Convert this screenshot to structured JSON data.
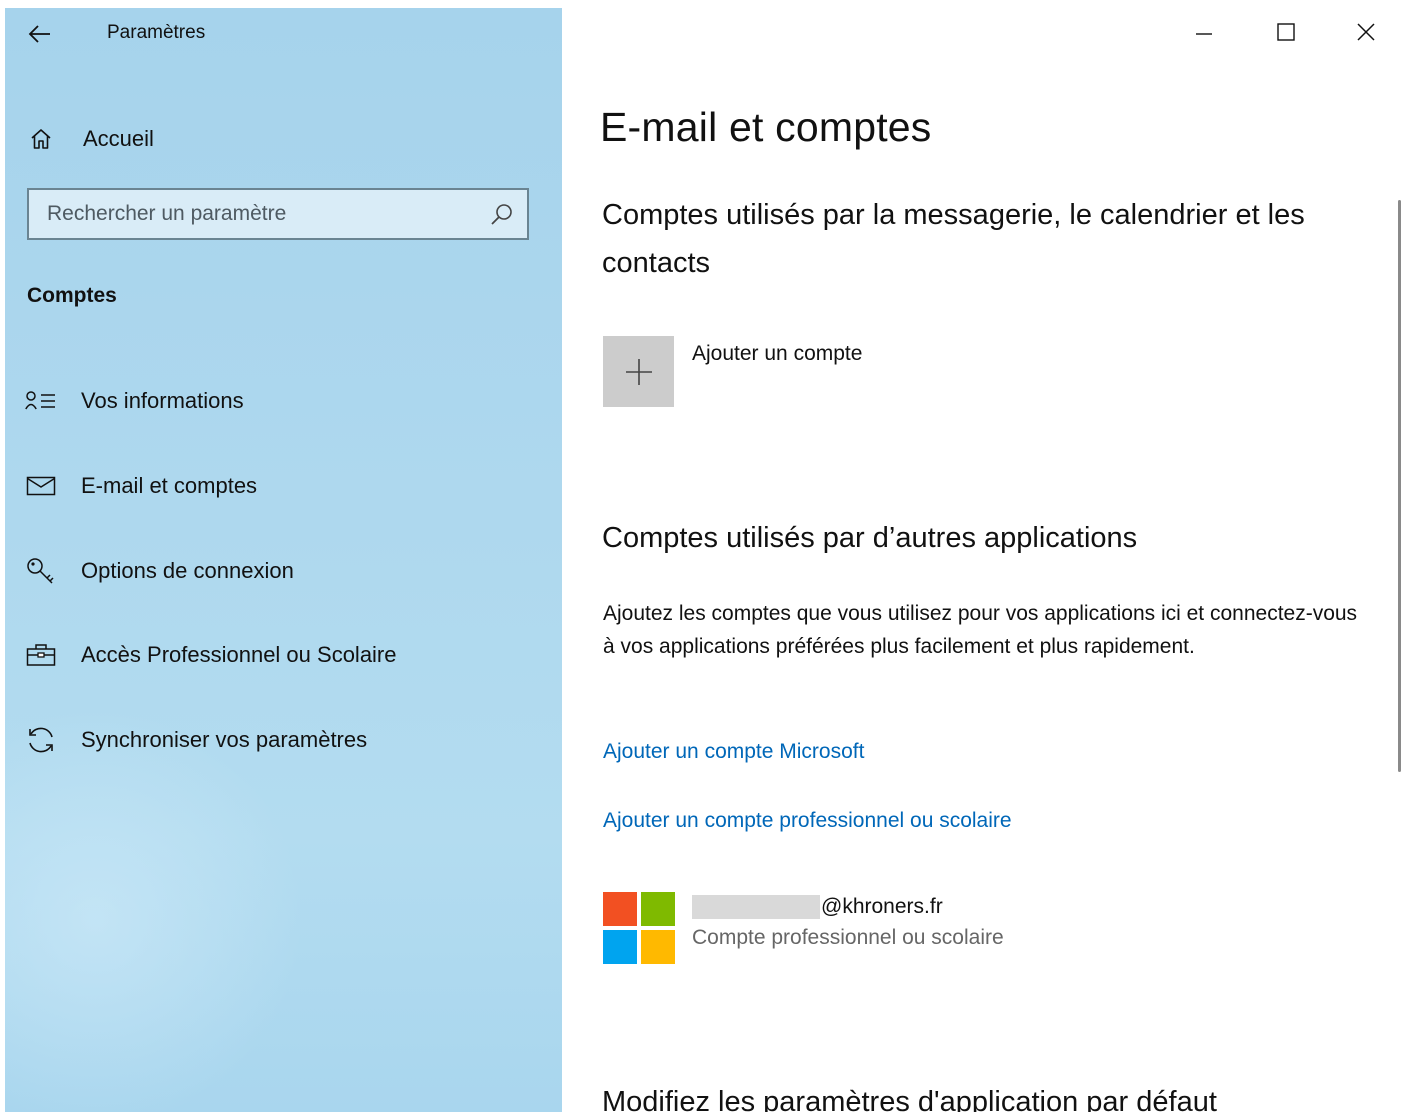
{
  "window": {
    "title": "Paramètres"
  },
  "sidebar": {
    "home_label": "Accueil",
    "search": {
      "placeholder": "Rechercher un paramètre",
      "value": ""
    },
    "section_label": "Comptes",
    "items": [
      {
        "label": "Vos informations",
        "icon": "person-list-icon"
      },
      {
        "label": "E-mail et comptes",
        "icon": "mail-icon"
      },
      {
        "label": "Options de connexion",
        "icon": "key-icon"
      },
      {
        "label": "Accès Professionnel ou Scolaire",
        "icon": "briefcase-icon"
      },
      {
        "label": "Synchroniser vos paramètres",
        "icon": "sync-icon"
      }
    ],
    "background_color": "#aed8ee"
  },
  "main": {
    "page_title": "E-mail et comptes",
    "section1": {
      "heading": "Comptes utilisés par la messagerie, le calendrier et les contacts",
      "add_account_label": "Ajouter un compte"
    },
    "section2": {
      "heading": "Comptes utilisés par d’autres applications",
      "description": "Ajoutez les comptes que vous utilisez pour vos applications ici et connectez-vous à vos applications préférées plus facilement et plus rapidement.",
      "link_microsoft": "Ajouter un compte Microsoft",
      "link_work": "Ajouter un compte professionnel ou scolaire",
      "account": {
        "email_suffix": "@khroners.fr",
        "type": "Compte professionnel ou scolaire"
      }
    },
    "section3": {
      "heading": "Modifiez les paramètres d'application par défaut"
    }
  },
  "colors": {
    "link": "#0067b8",
    "tile": "#cccccc",
    "ms_red": "#f25022",
    "ms_green": "#7fba00",
    "ms_blue": "#00a4ef",
    "ms_yellow": "#ffb900"
  }
}
